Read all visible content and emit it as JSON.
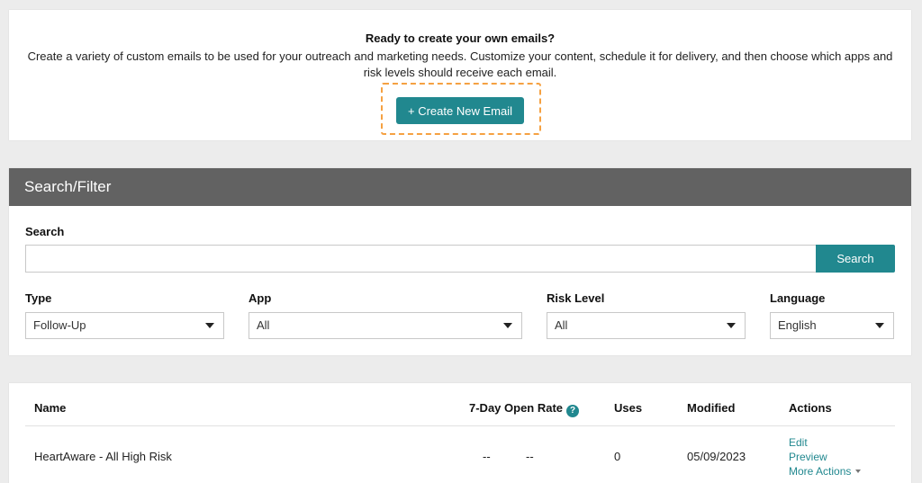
{
  "intro": {
    "title": "Ready to create your own emails?",
    "text": "Create a variety of custom emails to be used for your outreach and marketing needs. Customize your content, schedule it for delivery, and then choose which apps and risk levels should receive each email.",
    "create_button": "+ Create New Email"
  },
  "filter": {
    "header": "Search/Filter",
    "search_label": "Search",
    "search_value": "",
    "search_button": "Search",
    "type": {
      "label": "Type",
      "value": "Follow-Up"
    },
    "app": {
      "label": "App",
      "value": "All"
    },
    "risk": {
      "label": "Risk Level",
      "value": "All"
    },
    "language": {
      "label": "Language",
      "value": "English"
    }
  },
  "table": {
    "columns": {
      "name": "Name",
      "open_rate": "7-Day Open Rate",
      "uses": "Uses",
      "modified": "Modified",
      "actions": "Actions"
    },
    "help_glyph": "?",
    "rows": [
      {
        "name": "HeartAware - All High Risk",
        "open_rate_a": "--",
        "open_rate_b": "--",
        "uses": "0",
        "modified": "05/09/2023",
        "edit": "Edit",
        "preview": "Preview",
        "more": "More Actions"
      }
    ]
  },
  "colors": {
    "accent": "#21888f",
    "header_bg": "#626262",
    "highlight": "#f5a142",
    "page_bg": "#ececec"
  }
}
